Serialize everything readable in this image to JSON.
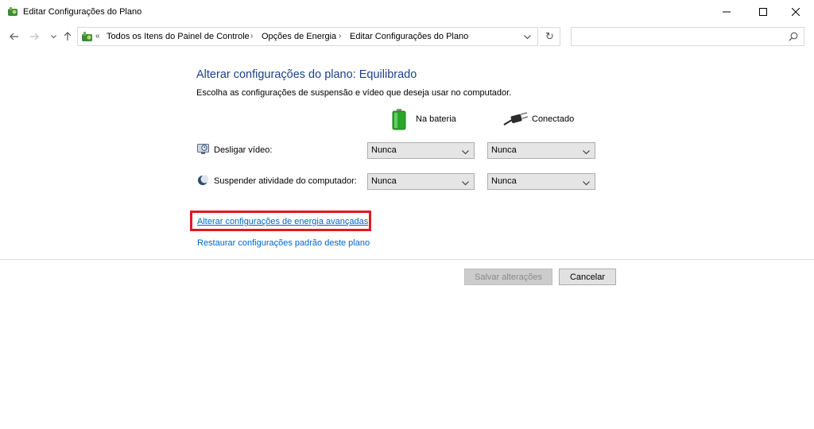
{
  "window": {
    "title": "Editar Configurações do Plano"
  },
  "address_bar": {
    "overflow": "«",
    "crumbs": [
      "Todos os Itens do Painel de Controle",
      "Opções de Energia",
      "Editar Configurações do Plano"
    ],
    "separator": "›"
  },
  "search": {
    "placeholder": ""
  },
  "main": {
    "heading": "Alterar configurações do plano: Equilibrado",
    "description": "Escolha as configurações de suspensão e vídeo que deseja usar no computador.",
    "columns": {
      "battery": "Na bateria",
      "plugged": "Conectado"
    },
    "settings": [
      {
        "label": "Desligar vídeo:",
        "battery_value": "Nunca",
        "plugged_value": "Nunca",
        "icon": "display-icon"
      },
      {
        "label": "Suspender atividade do computador:",
        "battery_value": "Nunca",
        "plugged_value": "Nunca",
        "icon": "sleep-moon-icon"
      }
    ],
    "advanced_link": "Alterar configurações de energia avançadas",
    "restore_link": "Restaurar configurações padrão deste plano"
  },
  "footer": {
    "save_label": "Salvar alterações",
    "cancel_label": "Cancelar"
  },
  "colors": {
    "heading": "#1e3f8a",
    "link": "#0066cc",
    "highlight": "#e0191f"
  }
}
